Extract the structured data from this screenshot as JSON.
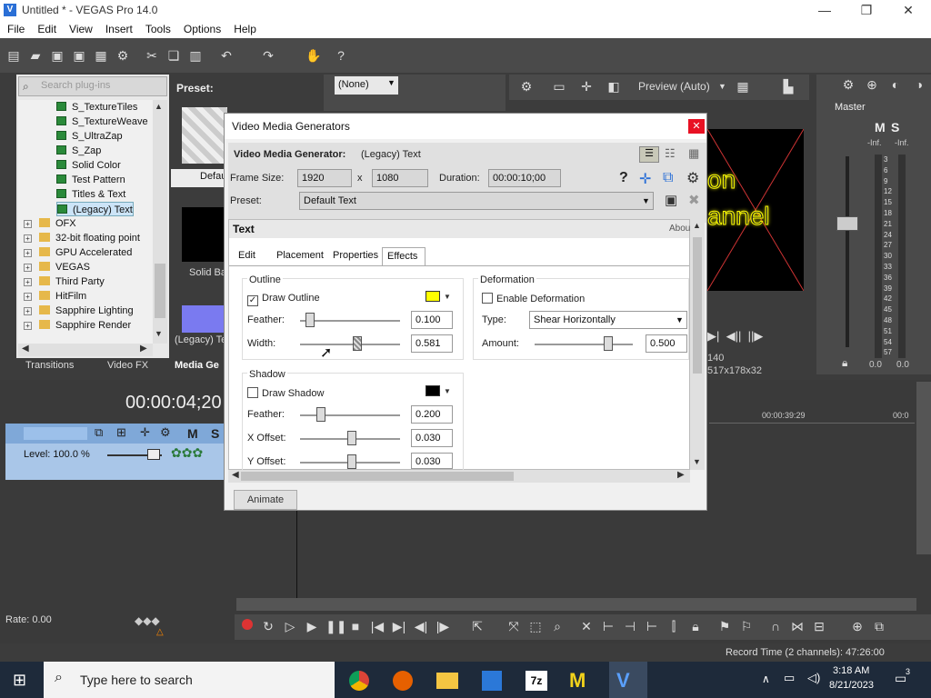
{
  "window": {
    "title": "Untitled * - VEGAS Pro 14.0",
    "controls": [
      "—",
      "❐",
      "✕"
    ]
  },
  "menu": [
    "File",
    "Edit",
    "View",
    "Insert",
    "Tools",
    "Options",
    "Help"
  ],
  "plugins": {
    "search_placeholder": "Search plug-ins",
    "preset_label": "Preset:",
    "items": [
      {
        "label": "S_TextureTiles",
        "type": "gen"
      },
      {
        "label": "S_TextureWeave",
        "type": "gen"
      },
      {
        "label": "S_UltraZap",
        "type": "gen"
      },
      {
        "label": "S_Zap",
        "type": "gen"
      },
      {
        "label": "Solid Color",
        "type": "gen"
      },
      {
        "label": "Test Pattern",
        "type": "gen"
      },
      {
        "label": "Titles & Text",
        "type": "gen"
      },
      {
        "label": "(Legacy) Text",
        "type": "gen"
      },
      {
        "label": "OFX",
        "type": "folder"
      },
      {
        "label": "32-bit floating point",
        "type": "folder"
      },
      {
        "label": "GPU Accelerated",
        "type": "folder"
      },
      {
        "label": "VEGAS",
        "type": "folder"
      },
      {
        "label": "Third Party",
        "type": "folder"
      },
      {
        "label": "HitFilm",
        "type": "folder"
      },
      {
        "label": "Sapphire Lighting",
        "type": "folder"
      },
      {
        "label": "Sapphire Render",
        "type": "folder"
      }
    ],
    "presets": [
      "Defau",
      "Solid Ba",
      "(Legacy) Te"
    ],
    "tabs": [
      "Transitions",
      "Video FX",
      "Media Ge"
    ]
  },
  "preview": {
    "none_select": "(None)",
    "mode": "Preview (Auto)",
    "video_text": "on\nannel",
    "info_a": "140",
    "info_b": "517x178x32"
  },
  "master": {
    "title": "Master",
    "m": "M",
    "s": "S",
    "inf_l": "-Inf.",
    "inf_r": "-Inf.",
    "scale": [
      "3",
      "6",
      "9",
      "12",
      "15",
      "18",
      "21",
      "24",
      "27",
      "30",
      "33",
      "36",
      "39",
      "42",
      "45",
      "48",
      "51",
      "54",
      "57"
    ],
    "val_l": "0.0",
    "val_r": "0.0"
  },
  "timeline": {
    "timecode": "00:00:04;20",
    "level": "Level: 100.0 %",
    "ruler_a": "00:00:39:29",
    "ruler_b": "00:0",
    "rate": "Rate: 0.00",
    "m": "M",
    "s": "S"
  },
  "status": {
    "record_time": "Record Time (2 channels): 47:26:00"
  },
  "dialog": {
    "title": "Video Media Generators",
    "generator_label": "Video Media Generator:",
    "generator_value": "(Legacy) Text",
    "frame_size_label": "Frame Size:",
    "width": "1920",
    "x": "x",
    "height": "1080",
    "duration_label": "Duration:",
    "duration": "00:00:10;00",
    "preset_label": "Preset:",
    "preset_value": "Default Text",
    "panel_title": "Text",
    "about": "Abou",
    "tabs": [
      "Edit",
      "Placement",
      "Properties",
      "Effects"
    ],
    "active_tab": "Effects",
    "outline": {
      "group": "Outline",
      "draw_label": "Draw Outline",
      "draw_checked": "✓",
      "color": "#ffff00",
      "feather_label": "Feather:",
      "feather": "0.100",
      "width_label": "Width:",
      "width": "0.581"
    },
    "deformation": {
      "group": "Deformation",
      "enable_label": "Enable Deformation",
      "type_label": "Type:",
      "type_value": "Shear Horizontally",
      "amount_label": "Amount:",
      "amount": "0.500"
    },
    "shadow": {
      "group": "Shadow",
      "draw_label": "Draw Shadow",
      "color": "#000000",
      "feather_label": "Feather:",
      "feather": "0.200",
      "xoffset_label": "X Offset:",
      "xoffset": "0.030",
      "yoffset_label": "Y Offset:",
      "yoffset": "0.030"
    },
    "animate": "Animate"
  },
  "taskbar": {
    "search": "Type here to search",
    "time": "3:18 AM",
    "date": "8/21/2023",
    "notify": "3"
  }
}
